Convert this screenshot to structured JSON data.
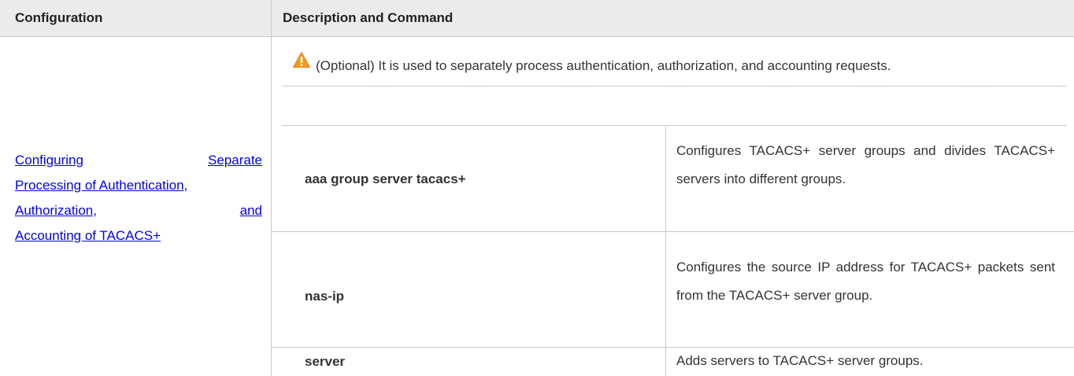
{
  "header": {
    "col1": "Configuration",
    "col2": "Description and Command"
  },
  "config_link_lines": [
    [
      "Configuring",
      "Separate"
    ],
    [
      "Processing of Authentication,"
    ],
    [
      "Authorization,",
      "and"
    ],
    [
      "Accounting of TACACS+"
    ]
  ],
  "note": {
    "icon": "warning-icon",
    "text": "(Optional) It is used to separately process authentication, authorization, and accounting requests."
  },
  "rows": [
    {
      "command": "aaa group server tacacs+",
      "description": "Configures TACACS+ server groups and divides TACACS+ servers into different groups."
    },
    {
      "command": "nas-ip",
      "description": "Configures the source IP address for TACACS+ packets sent from the TACACS+ server group."
    },
    {
      "command": "server",
      "description": "Adds servers to TACACS+ server groups."
    }
  ],
  "colors": {
    "header_bg": "#ebebeb",
    "link": "#0000ee",
    "warning": "#f39c12"
  }
}
